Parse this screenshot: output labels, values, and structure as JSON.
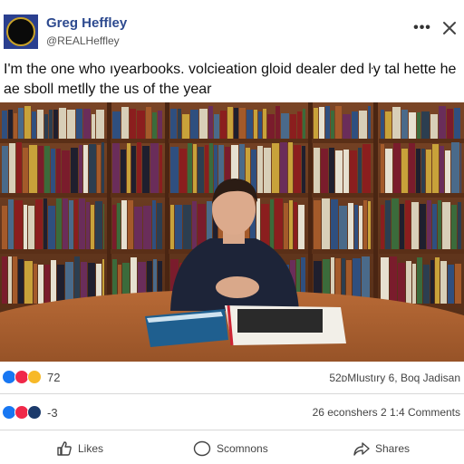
{
  "post": {
    "author_name": "Greg Heffley",
    "author_handle": "@REALHeffley",
    "more_label": "•••",
    "text": "I'm the one who ıyearbooks. volcieation ɡloid dealer ded ŀy tal hette he ae sboll metlly the us of the year"
  },
  "photo": {
    "icon": "library-photo"
  },
  "stats": {
    "reaction_count": "72",
    "meta_right": "52ᴅMlustıry 6, Boq Jadisan",
    "reaction_count_2": "-3",
    "meta_right_2": "26 econshers 2 1:4 Comments"
  },
  "actions": {
    "like_label": "Likes",
    "comment_label": "Scomnons",
    "share_label": "Shares"
  },
  "colors": {
    "author": "#2d4a8f",
    "like_blue": "#1877f2",
    "love_red": "#f02849",
    "haha_yellow": "#f7b928"
  }
}
